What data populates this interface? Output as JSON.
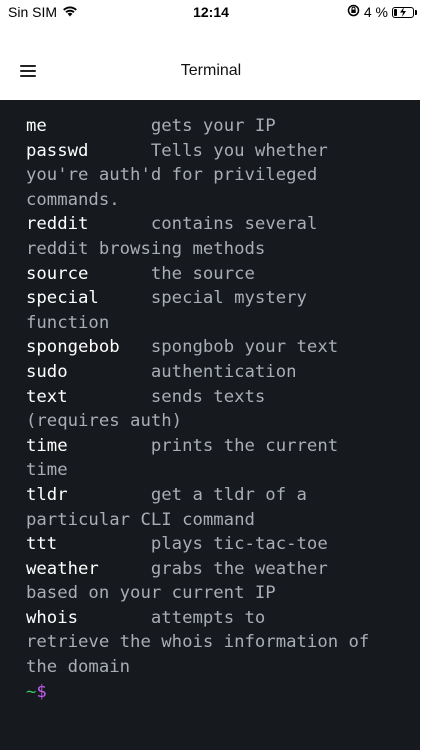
{
  "status_bar": {
    "carrier": "Sin SIM",
    "time": "12:14",
    "battery": "4 %",
    "battery_level": 0.04
  },
  "nav": {
    "title": "Terminal",
    "menu_icon": "hamburger-icon"
  },
  "terminal": {
    "lines": [
      {
        "cmd": "me",
        "desc": "gets your IP"
      },
      {
        "cmd": "passwd",
        "desc": "Tells you whether"
      },
      {
        "cmd": "",
        "desc": "you're auth'd for privileged"
      },
      {
        "cmd": "",
        "desc": "commands."
      },
      {
        "cmd": "reddit",
        "desc": "contains several"
      },
      {
        "cmd": "",
        "desc": "reddit browsing methods"
      },
      {
        "cmd": "source",
        "desc": "the source"
      },
      {
        "cmd": "special",
        "desc": "special mystery"
      },
      {
        "cmd": "",
        "desc": "function"
      },
      {
        "cmd": "spongebob",
        "desc": "spongbob your text"
      },
      {
        "cmd": "sudo",
        "desc": "authentication"
      },
      {
        "cmd": "text",
        "desc": "sends texts"
      },
      {
        "cmd": "",
        "desc": "(requires auth)"
      },
      {
        "cmd": "time",
        "desc": "prints the current"
      },
      {
        "cmd": "",
        "desc": "time"
      },
      {
        "cmd": "tldr",
        "desc": "get a tldr of a"
      },
      {
        "cmd": "",
        "desc": "particular CLI command"
      },
      {
        "cmd": "ttt",
        "desc": "plays tic-tac-toe"
      },
      {
        "cmd": "weather",
        "desc": "grabs the weather"
      },
      {
        "cmd": "",
        "desc": "based on your current IP"
      },
      {
        "cmd": "whois",
        "desc": "attempts to"
      },
      {
        "cmd": "",
        "desc": "retrieve the whois information of"
      },
      {
        "cmd": "",
        "desc": "the domain"
      }
    ],
    "prompt_tilde": "~",
    "prompt_dollar": "$"
  },
  "colors": {
    "terminal_bg": "#16191e",
    "command_text": "#ffffff",
    "description_text": "#a9adb4",
    "prompt_tilde": "#3bc463",
    "prompt_dollar": "#c45ef0"
  }
}
